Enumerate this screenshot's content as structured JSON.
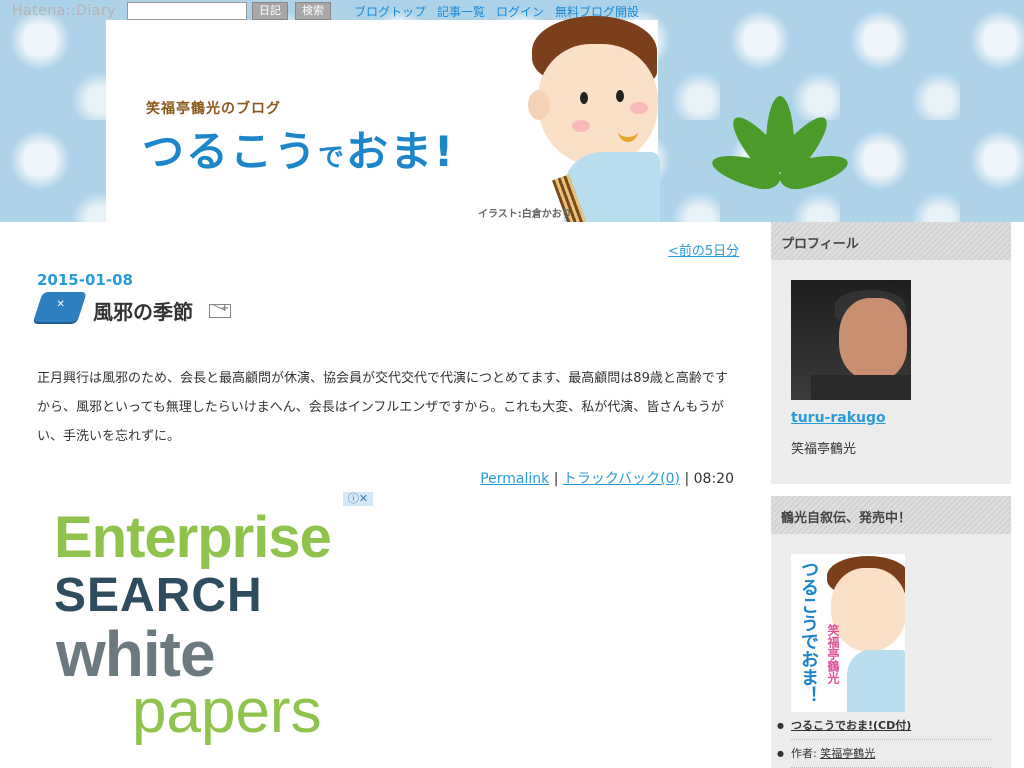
{
  "topbar": {
    "logo": "Hatena::Diary",
    "search_placeholder": "",
    "diary_button": "日記",
    "search_button": "検索",
    "nav": [
      "ブログトップ",
      "記事一覧",
      "ログイン",
      "無料ブログ開設"
    ]
  },
  "banner": {
    "kicker": "笑福亭鶴光のブログ",
    "title_part1": "つるこう",
    "title_small": "で",
    "title_part2": "おま!",
    "credit": "イラスト:白倉かおり"
  },
  "main": {
    "prev_link": "<前の5日分",
    "entry": {
      "date": "2015-01-08",
      "title": "風邪の季節",
      "body": "正月興行は風邪のため、会長と最高顧問が休演、協会員が交代交代で代演につとめてます、最高顧問は89歳と高齢ですから、風邪といっても無理したらいけまへん、会長はインフルエンザですから。これも大変、私が代演、皆さんもうがい、手洗いを忘れずに。",
      "permalink": "Permalink",
      "separator": "|",
      "trackback": "トラックバック(0)",
      "time": "08:20"
    }
  },
  "ad": {
    "info": "ⓘ✕",
    "line1": "Enterprise",
    "line2": "SEARCH",
    "line3": "white",
    "line4": "papers"
  },
  "sidebar": {
    "profile": {
      "heading": "プロフィール",
      "user_id": "turu-rakugo",
      "name": "笑福亭鶴光"
    },
    "book": {
      "heading": "鶴光自叙伝、発売中！",
      "cover_title": "つるこうでおま！",
      "cover_author": "笑福亭鶴光",
      "item_title": "つるこうでおま!(CD付)",
      "author_label": "作者: ",
      "author_name": "笑福亭鶴光"
    }
  },
  "colors": {
    "link": "#2a9bd9",
    "banner_bg": "#aed3e9",
    "title": "#1d85c9",
    "sidebar_bg": "#ececec"
  }
}
